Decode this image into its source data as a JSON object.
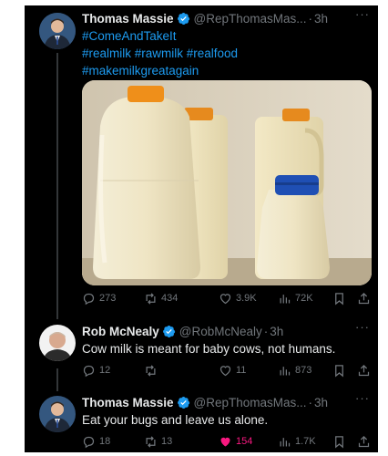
{
  "tweets": [
    {
      "name": "Thomas Massie",
      "handle": "@RepThomasMas...",
      "separator": "·",
      "time": "3h",
      "more": "···",
      "hashtags": [
        "#ComeAndTakeIt",
        "#realmilk #rawmilk #realfood",
        "#makemilkgreatagain"
      ],
      "stats": {
        "replies": "273",
        "reposts": "434",
        "likes": "3.9K",
        "views": "72K"
      }
    },
    {
      "name": "Rob McNealy",
      "handle": "@RobMcNealy",
      "separator": "·",
      "time": "3h",
      "more": "···",
      "text": "Cow milk is meant for baby cows, not humans.",
      "stats": {
        "replies": "12",
        "reposts": "",
        "likes": "11",
        "views": "873"
      }
    },
    {
      "name": "Thomas Massie",
      "handle": "@RepThomasMas...",
      "separator": "·",
      "time": "3h",
      "more": "···",
      "text": "Eat your bugs and leave us alone.",
      "stats": {
        "replies": "18",
        "reposts": "13",
        "likes": "154",
        "views": "1.7K"
      },
      "liked": true
    }
  ],
  "colors": {
    "background": "#000000",
    "text": "#e7e9ea",
    "secondary": "#71767b",
    "link": "#1d9bf0",
    "like": "#f91880",
    "verified": "#1d9bf0"
  },
  "icons": [
    "verified-badge-icon",
    "reply-icon",
    "repost-icon",
    "like-icon",
    "views-icon",
    "bookmark-icon",
    "share-icon",
    "more-icon"
  ]
}
